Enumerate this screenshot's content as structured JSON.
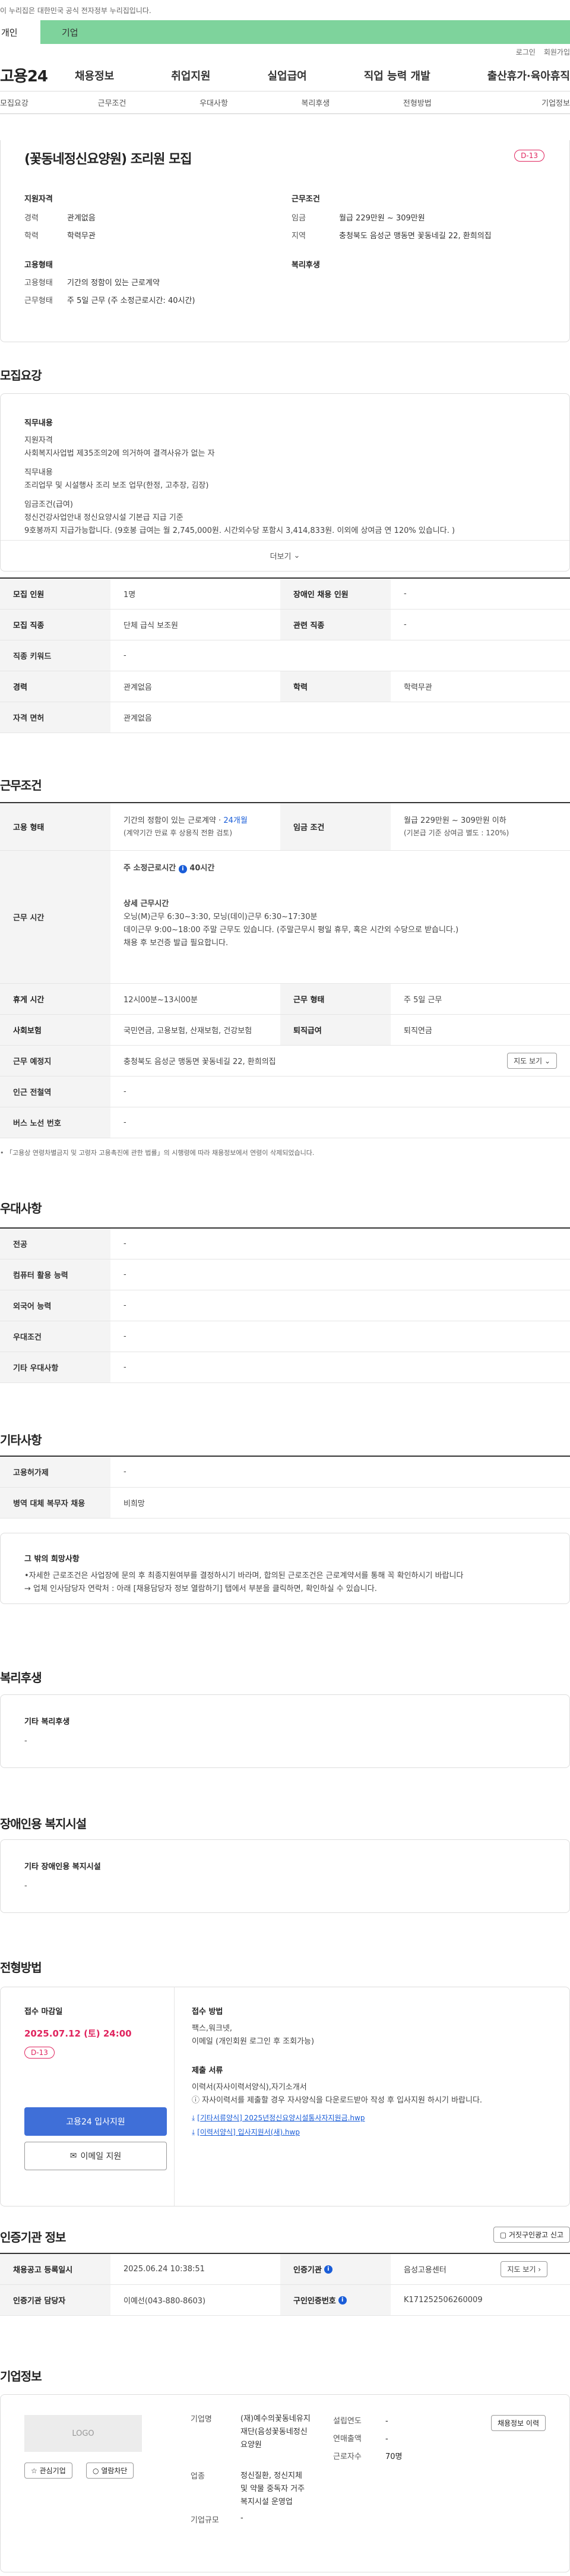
{
  "notice": "이 누리집은 대한민국 공식 전자정부 누리집입니다.",
  "tabs": [
    "개인",
    "기업"
  ],
  "util": [
    "로그인",
    "회원가입"
  ],
  "logo": "고용24",
  "gnb": [
    "채용정보",
    "취업지원",
    "실업급여",
    "직업 능력 개발",
    "출산휴가·육아휴직"
  ],
  "lnb": [
    "모집요강",
    "근무조건",
    "우대사항",
    "복리후생",
    "전형방법",
    "기업정보"
  ],
  "job": {
    "title": "(꽃동네정신요양원) 조리원 모집",
    "dday": "D-13",
    "qual_h": "지원자격",
    "exp_k": "경력",
    "exp_v": "관계없음",
    "edu_k": "학력",
    "edu_v": "학력무관",
    "emp_h": "고용형태",
    "emp_k": "고용형태",
    "emp_v": "기간의 정함이 있는 근로계약",
    "work_k": "근무형태",
    "work_v": "주 5일 근무 (주 소정근로시간: 40시간)",
    "cond_h": "근무조건",
    "wage_k": "임금",
    "wage_v": "월급 229만원 ~ 309만원",
    "loc_k": "지역",
    "loc_v": "충청북도 음성군 맹동면 꽃동네길 22, 환희의집",
    "welfare_h": "복리후생"
  },
  "recruit": {
    "title": "모집요강",
    "duty_h": "직무내용",
    "lines": [
      "지원자격",
      "사회복지사업법 제35조의2에 의거하여 결격사유가 없는 자",
      "직무내용",
      "조리업무 및 시설행사 조리 보조 업무(한정, 고추장, 김장)",
      "임금조건(급여)",
      "정신건강사업안내 정신요양시설 기본급 지급 기준",
      "9호봉까지 지급가능합니다. (9호봉 급여는 월 2,745,000원. 시간외수당 포함시 3,414,833원. 이외에 상여금 연 120% 있습니다. )"
    ],
    "more": "더보기",
    "rows": [
      [
        "모집 인원",
        "1명",
        "장애인 채용 인원",
        "-"
      ],
      [
        "모집 직종",
        "단체 급식 보조원",
        "관련 직종",
        "-"
      ],
      [
        "직종 키워드",
        "-"
      ],
      [
        "경력",
        "관계없음",
        "학력",
        "학력무관"
      ],
      [
        "자격 면허",
        "관계없음"
      ]
    ]
  },
  "workcond": {
    "title": "근무조건",
    "emp_k": "고용 형태",
    "emp_v1": "기간의 정함이 있는 근로계약 ·",
    "emp_months": "24개월",
    "emp_v2": "(계약기간 만료 후 상용직 전환 검토)",
    "wage_k": "임금 조건",
    "wage_v1": "월급 229만원 ~ 309만원 이하",
    "wage_v2": "(기본급 기준 상여금 별도 : 120%)",
    "time_k": "근무 시간",
    "week_h": "주 소정근로시간",
    "week_v": "40시간",
    "detail_h": "상세 근무시간",
    "detail": [
      "오닝(M)근무 6:30~3:30, 모닝(데이)근무 6:30~17:30분",
      "데이근무 9:00~18:00 주말 근무도 있습니다. (주말근무시 평일 휴무, 혹은 시간외 수당으로 받습니다.)",
      "채용 후 보건증 발급 필요합니다."
    ],
    "rows": [
      [
        "휴게 시간",
        "12시00분~13시00분",
        "근무 형태",
        "주 5일 근무"
      ],
      [
        "사회보험",
        "국민연금, 고용보험, 산재보험, 건강보험",
        "퇴직급여",
        "퇴직연금"
      ],
      [
        "근무 예정지",
        "충청북도 음성군 맹동면 꽃동네길 22, 환희의집"
      ],
      [
        "인근 전철역",
        "-"
      ],
      [
        "버스 노선 번호",
        "-"
      ]
    ],
    "map_btn": "지도 보기",
    "note": "「고용상 연령차별금지 및 고령자 고용촉진에 관한 법률」의 시행령에 따라 채용정보에서 연령이 삭제되었습니다."
  },
  "pref": {
    "title": "우대사항",
    "rows": [
      [
        "전공",
        "-"
      ],
      [
        "컴퓨터 활용 능력",
        "-"
      ],
      [
        "외국어 능력",
        "-"
      ],
      [
        "우대조건",
        "-"
      ],
      [
        "기타 우대사항",
        "-"
      ]
    ]
  },
  "etc": {
    "title": "기타사항",
    "rows": [
      [
        "고용허가제",
        "-"
      ],
      [
        "병역 대체 복무자 채용",
        "비희망"
      ]
    ],
    "box_h": "그 밖의 희망사항",
    "box_1": "•자세한 근로조건은 사업장에 문의 후 최종지원여부를 결정하시기 바라며, 합의된 근로조건은 근로계약서를 통해 꼭 확인하시기 바랍니다",
    "box_2": "→ 업체 인사담당자 연락처 : 아래 [채용담당자 정보 열람하기] 탭에서 부분을 클릭하면, 확인하실 수 있습니다."
  },
  "welfare": {
    "title": "복리후생",
    "box_h": "기타 복리후생",
    "box_v": "-"
  },
  "disab": {
    "title": "장애인용 복지시설",
    "box_h": "기타 장애인용 복지시설",
    "box_v": "-"
  },
  "screen": {
    "title": "전형방법",
    "deadline_h": "접수 마감일",
    "deadline_v": "2025.07.12 (토) 24:00",
    "dday": "D-13",
    "apply_btn": "고용24 입사지원",
    "email_btn": "이메일 지원",
    "method_h": "접수 방법",
    "method_lines": [
      "팩스,워크넷,",
      "이메일 (개인회원 로그인 후 조회가능)"
    ],
    "docs_h": "제출 서류",
    "docs_v": "이력서(자사이력서양식),자기소개서",
    "docs_note": "자사이력서를 제출할 경우 자사양식을 다운로드받아 작성 후 입사지원 하시기 바랍니다.",
    "files": [
      "[기타서류양식] 2025년정신요양시설통사자지원금.hwp",
      "[이력서양식] 입사지원서(새).hwp"
    ]
  },
  "cert": {
    "title": "인증기관 정보",
    "btn": "거짓구인광고 신고",
    "rows": [
      [
        "채용공고 등록일시",
        "2025.06.24 10:38:51",
        "인증기관",
        "음성고용센터"
      ],
      [
        "인증기관 담당자",
        "이예선(043-880-8603)",
        "구인인증번호",
        "K171252506260009"
      ]
    ],
    "map_btn": "지도 보기"
  },
  "company": {
    "title": "기업정보",
    "logo": "LOGO",
    "fav_btn": "관심기업",
    "mail_btn": "열람차단",
    "detail_btn": "채용정보 이력",
    "name_k": "기업명",
    "name_v": "(재)예수의꽃동네유지재단(음성꽃동네정신요양원",
    "found_k": "설립연도",
    "found_v": "-",
    "sales_k": "연매출액",
    "sales_v": "-",
    "staff_k": "근로자수",
    "staff_v": "70명",
    "ind_k": "업종",
    "ind_v": "정신질환, 정신지체 및 약물 중독자 거주 복지시설 운영업",
    "size_k": "기업규모",
    "size_v": "-"
  },
  "colors": {
    "accent": "#1a5dd8",
    "dday": "#e0245e",
    "tab_green": "#7ed39c",
    "apply_btn": "#3f6fd8"
  }
}
